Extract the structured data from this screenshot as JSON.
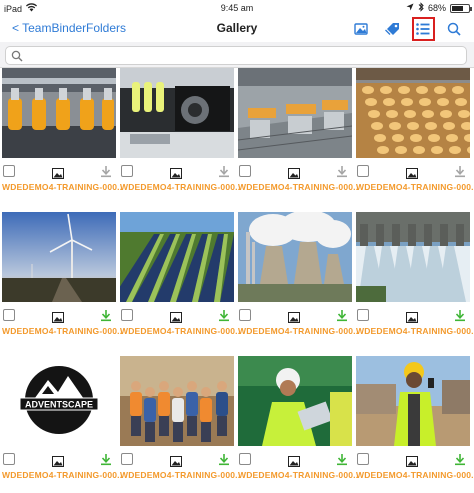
{
  "status_bar": {
    "device": "iPad",
    "time": "9:45 am",
    "battery": "68%",
    "battery_level": 0.68
  },
  "nav": {
    "back_label": "< TeamBinder",
    "folders_label": "Folders",
    "title": "Gallery",
    "accent": "#2f7bd6",
    "highlight": "#d9201f"
  },
  "search": {
    "placeholder": "",
    "value": ""
  },
  "items": [
    {
      "name": "WDEDEMO4-TRAINING-000...",
      "image": "juice-bottling-line",
      "downloaded": false
    },
    {
      "name": "WDEDEMO4-TRAINING-000...",
      "image": "bottle-filling-machine",
      "downloaded": false
    },
    {
      "name": "WDEDEMO4-TRAINING-000...",
      "image": "factory-floor",
      "downloaded": false
    },
    {
      "name": "WDEDEMO4-TRAINING-000...",
      "image": "biscuit-conveyor",
      "downloaded": false
    },
    {
      "name": "WDEDEMO4-TRAINING-000...",
      "image": "wind-turbine-sunset",
      "downloaded": true
    },
    {
      "name": "WDEDEMO4-TRAINING-000...",
      "image": "solar-panel-field",
      "downloaded": true
    },
    {
      "name": "WDEDEMO4-TRAINING-000...",
      "image": "power-station-towers",
      "downloaded": true
    },
    {
      "name": "WDEDEMO4-TRAINING-000...",
      "image": "dam-spillway",
      "downloaded": true
    },
    {
      "name": "WDEDEMO4-TRAINING-000...",
      "image": "adventscape-logo",
      "logo_text": "ADVENTSCAPE",
      "downloaded": true
    },
    {
      "name": "WDEDEMO4-TRAINING-000...",
      "image": "team-group-photo",
      "downloaded": true
    },
    {
      "name": "WDEDEMO4-TRAINING-000...",
      "image": "construction-worker-tablet",
      "downloaded": true
    },
    {
      "name": "WDEDEMO4-TRAINING-000...",
      "image": "site-engineer-phone",
      "downloaded": true
    }
  ]
}
